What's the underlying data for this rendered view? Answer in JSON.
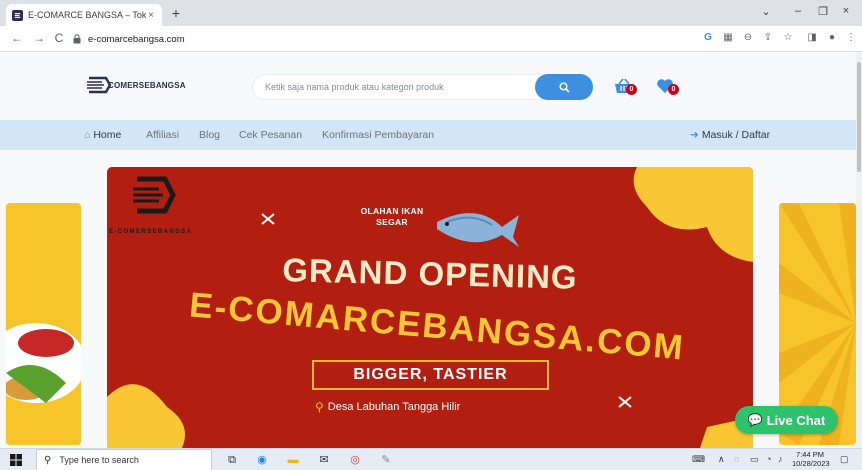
{
  "browser": {
    "tab_title": "E-COMARCE BANGSA – Toko O...",
    "tab_close": "×",
    "new_tab": "+",
    "win_chevron": "⌄",
    "win_minimize": "–",
    "win_restore": "❐",
    "win_close": "×",
    "back": "←",
    "forward": "→",
    "reload": "C",
    "url": "e-comarcebangsa.com",
    "lock": "🔒",
    "menu": "⋮"
  },
  "site": {
    "brand": "COMERSEBANGSA",
    "search_placeholder": "Ketik saja nama produk atau kategori produk",
    "cart_count": "0",
    "wishlist_count": "0",
    "menu": {
      "home": "Home",
      "affiliasi": "Affiliasi",
      "blog": "Blog",
      "cek_pesanan": "Cek Pesanan",
      "konfirmasi": "Konfirmasi Pembayaran",
      "login": "Masuk / Daftar"
    }
  },
  "banner": {
    "brand_small": "E-COMERSEBANGSA",
    "tag": "OLAHAN IKAN SEGAR",
    "headline": "GRAND OPENING",
    "domain": "E-COMARCEBANGSA.COM",
    "slogan": "BIGGER, TASTIER",
    "location": "Desa Labuhan Tangga Hilir"
  },
  "live_chat": {
    "label": "Live Chat"
  },
  "taskbar": {
    "search_placeholder": "Type here to search",
    "time": "7:44 PM",
    "date": "10/28/2023"
  },
  "colors": {
    "accent_blue": "#3f8fe0",
    "banner_red": "#b21f10",
    "banner_yellow": "#f8c733",
    "menubar": "#d3e6f7",
    "live_chat_green": "#2ec36a",
    "badge_red": "#d0021b"
  }
}
